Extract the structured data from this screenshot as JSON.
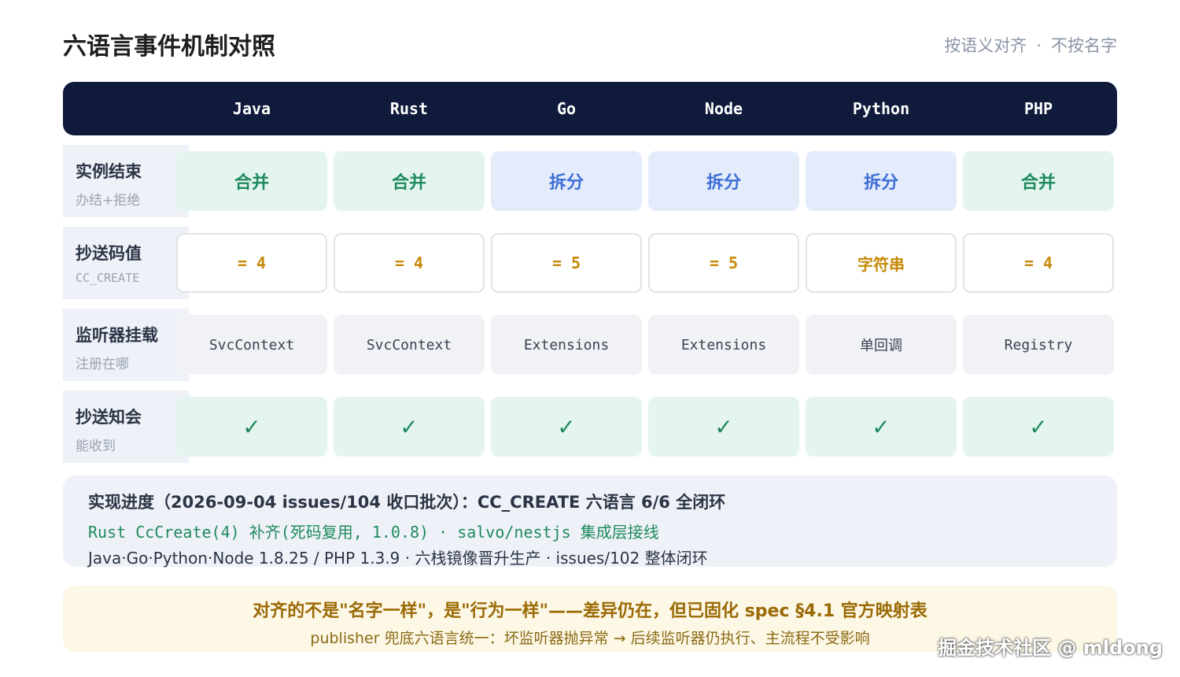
{
  "title": "六语言事件机制对照",
  "subtitle": {
    "left": "按语义对齐",
    "sep": "·",
    "right": "不按名字"
  },
  "columns": [
    "Java",
    "Rust",
    "Go",
    "Node",
    "Python",
    "PHP"
  ],
  "rows": [
    {
      "label": "实例结束",
      "sublabel": "办结+拒绝",
      "cells": [
        "合并",
        "合并",
        "拆分",
        "拆分",
        "拆分",
        "合并"
      ]
    },
    {
      "label": "抄送码值",
      "sublabel": "CC_CREATE",
      "cells": [
        "= 4",
        "= 4",
        "= 5",
        "= 5",
        "字符串",
        "= 4"
      ]
    },
    {
      "label": "监听器挂载",
      "sublabel": "注册在哪",
      "cells": [
        "SvcContext",
        "SvcContext",
        "Extensions",
        "Extensions",
        "单回调",
        "Registry"
      ]
    },
    {
      "label": "抄送知会",
      "sublabel": "能收到",
      "cells": [
        "✓",
        "✓",
        "✓",
        "✓",
        "✓",
        "✓"
      ]
    }
  ],
  "progress": {
    "line1": "实现进度（2026-09-04 issues/104 收口批次）：CC_CREATE 六语言 6/6 全闭环",
    "line2": "Rust CcCreate(4) 补齐(死码复用, 1.0.8) · salvo/nestjs 集成层接线",
    "line3": "Java·Go·Python·Node 1.8.25 / PHP 1.3.9 · 六栈镜像晋升生产 · issues/102 整体闭环"
  },
  "footer": {
    "line1": "对齐的不是\"名字一样\"，是\"行为一样\"——差异仍在，但已固化 spec §4.1 官方映射表",
    "line2": "publisher 兜底六语言统一：坏监听器抛异常 → 后续监听器仍执行、主流程不受影响"
  },
  "watermark": "掘金技术社区 @ mldong",
  "colors": {
    "header_bg": "#101a3a",
    "merge_green": "#1f8a5e",
    "split_blue": "#3d6fd6",
    "value_amber": "#c68a06"
  }
}
